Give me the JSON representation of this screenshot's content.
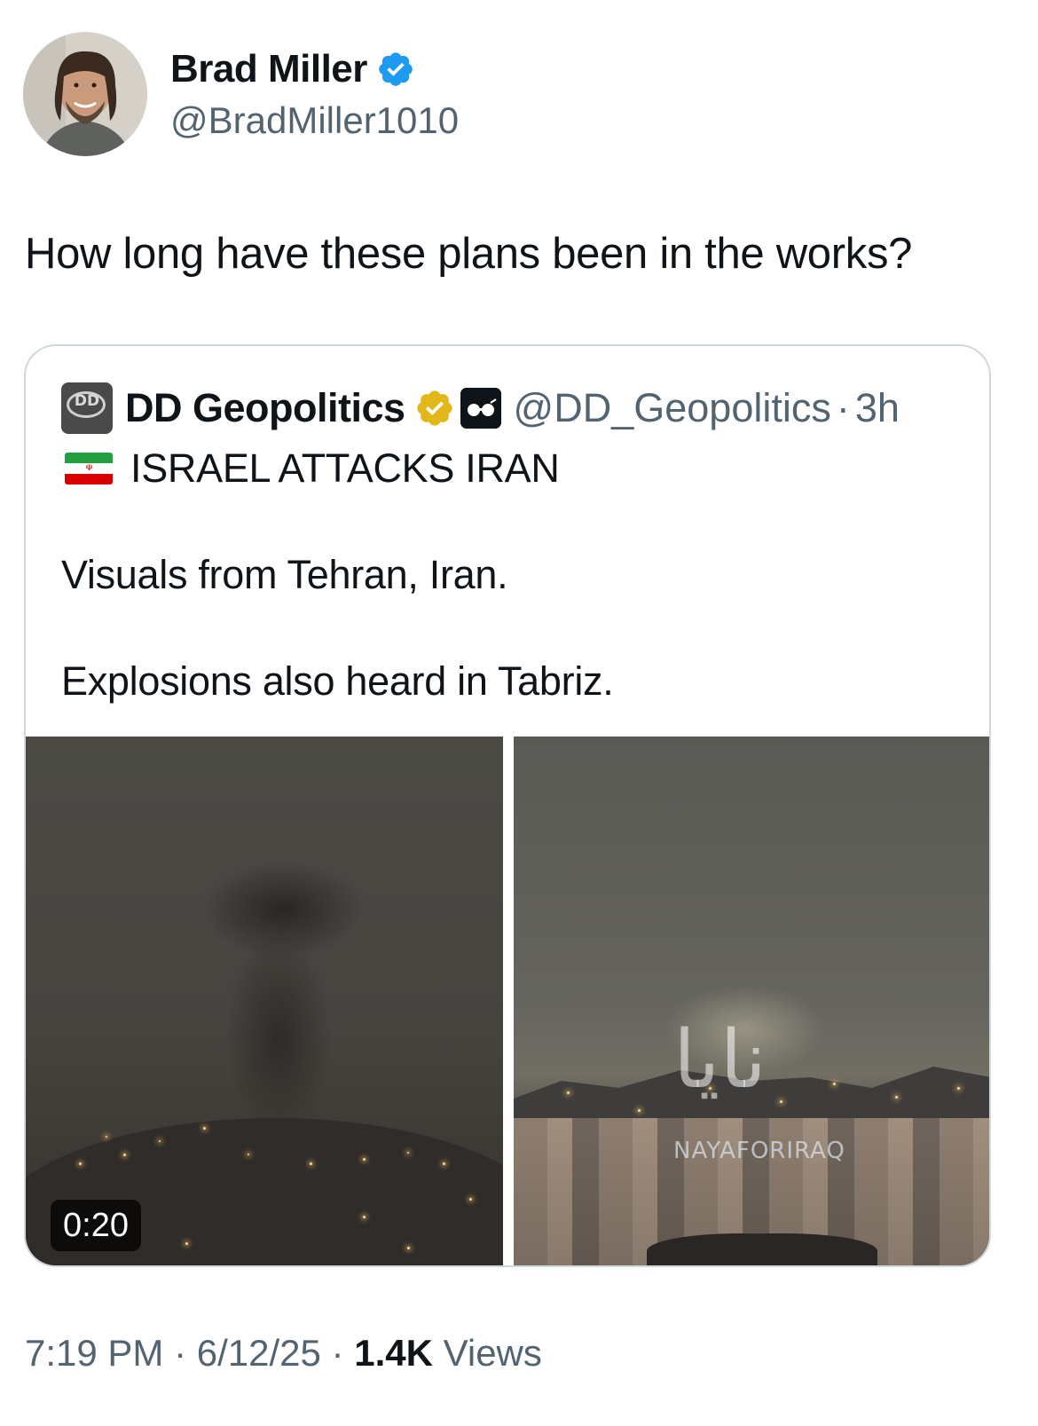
{
  "author": {
    "name": "Brad Miller",
    "handle": "@BradMiller1010",
    "verified_color": "#1d9bf0"
  },
  "tweet": {
    "text": "How long have these plans been in the works?"
  },
  "quoted": {
    "name": "DD Geopolitics",
    "avatar_text": "DD",
    "handle": "@DD_Geopolitics",
    "separator": "·",
    "time": "3h",
    "badge_color": "#e2b719",
    "flag_icon": "iran-flag-icon",
    "headline": "ISRAEL ATTACKS IRAN",
    "paragraph1": "Visuals from Tehran, Iran.",
    "paragraph2": "Explosions also heard in Tabriz.",
    "media": {
      "video_duration": "0:20",
      "watermark_text": "نایا",
      "watermark_channel": "NAYAFORIRAQ"
    }
  },
  "meta": {
    "time": "7:19 PM",
    "sep1": " · ",
    "date": "6/12/25",
    "sep2": " · ",
    "views_count": "1.4K",
    "views_label": " Views"
  }
}
